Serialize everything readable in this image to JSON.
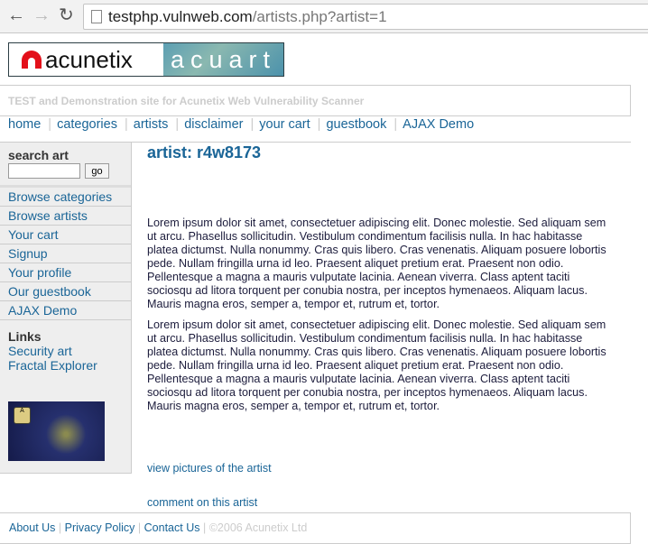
{
  "browser": {
    "url_host": "testphp.vulnweb.com",
    "url_path": "/artists.php?artist=1"
  },
  "logo": {
    "left": "acunetix",
    "right": "acuart"
  },
  "header": {
    "tagline": "TEST and Demonstration site for Acunetix Web Vulnerability Scanner"
  },
  "nav": [
    {
      "label": "home"
    },
    {
      "label": "categories"
    },
    {
      "label": "artists"
    },
    {
      "label": "disclaimer"
    },
    {
      "label": "your cart"
    },
    {
      "label": "guestbook"
    },
    {
      "label": "AJAX Demo"
    }
  ],
  "sidebar": {
    "search_title": "search art",
    "search_value": "",
    "go_label": "go",
    "items": [
      {
        "label": "Browse categories"
      },
      {
        "label": "Browse artists"
      },
      {
        "label": "Your cart"
      },
      {
        "label": "Signup"
      },
      {
        "label": "Your profile"
      },
      {
        "label": "Our guestbook"
      },
      {
        "label": "AJAX Demo"
      }
    ],
    "links_title": "Links",
    "links": [
      {
        "label": "Security art"
      },
      {
        "label": "Fractal Explorer"
      }
    ]
  },
  "main": {
    "title": "artist: r4w8173",
    "paragraphs": [
      "Lorem ipsum dolor sit amet, consectetuer adipiscing elit. Donec molestie. Sed aliquam sem ut arcu. Phasellus sollicitudin. Vestibulum condimentum facilisis nulla. In hac habitasse platea dictumst. Nulla nonummy. Cras quis libero. Cras venenatis. Aliquam posuere lobortis pede. Nullam fringilla urna id leo. Praesent aliquet pretium erat. Praesent non odio. Pellentesque a magna a mauris vulputate lacinia. Aenean viverra. Class aptent taciti sociosqu ad litora torquent per conubia nostra, per inceptos hymenaeos. Aliquam lacus. Mauris magna eros, semper a, tempor et, rutrum et, tortor.",
      "Lorem ipsum dolor sit amet, consectetuer adipiscing elit. Donec molestie. Sed aliquam sem ut arcu. Phasellus sollicitudin. Vestibulum condimentum facilisis nulla. In hac habitasse platea dictumst. Nulla nonummy. Cras quis libero. Cras venenatis. Aliquam posuere lobortis pede. Nullam fringilla urna id leo. Praesent aliquet pretium erat. Praesent non odio. Pellentesque a magna a mauris vulputate lacinia. Aenean viverra. Class aptent taciti sociosqu ad litora torquent per conubia nostra, per inceptos hymenaeos. Aliquam lacus. Mauris magna eros, semper a, tempor et, rutrum et, tortor."
    ],
    "view_pictures": "view pictures of the artist",
    "comment": "comment on this artist"
  },
  "footer": {
    "about": "About Us",
    "privacy": "Privacy Policy",
    "contact": "Contact Us",
    "copyright": "©2006 Acunetix Ltd",
    "sep": "|"
  }
}
